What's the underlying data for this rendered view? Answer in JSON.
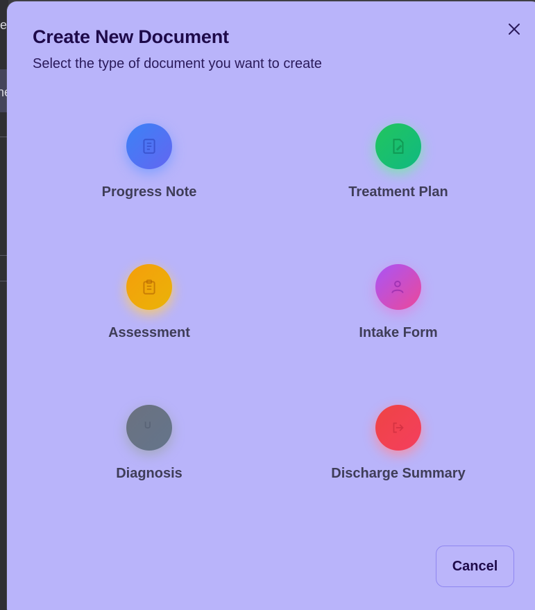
{
  "backdrop": {
    "text_1": "le",
    "text_2": "ne"
  },
  "modal": {
    "title": "Create New Document",
    "subtitle": "Select the type of document you want to create",
    "close_icon": "close-icon",
    "cancel_label": "Cancel"
  },
  "options": [
    {
      "label": "Progress Note",
      "icon": "note-icon",
      "gradient": [
        "#3b82f6",
        "#6366f1"
      ],
      "glow": "#7fa0ff"
    },
    {
      "label": "Treatment Plan",
      "icon": "document-edit-icon",
      "gradient": [
        "#22c55e",
        "#10b981"
      ],
      "glow": "#7ee2b0"
    },
    {
      "label": "Assessment",
      "icon": "clipboard-icon",
      "gradient": [
        "#f59e0b",
        "#eab308"
      ],
      "glow": "#f7c96b"
    },
    {
      "label": "Intake Form",
      "icon": "user-plus-icon",
      "gradient": [
        "#a855f7",
        "#ec4899"
      ],
      "glow": "#d58fe6"
    },
    {
      "label": "Diagnosis",
      "icon": "stethoscope-icon",
      "gradient": [
        "#6b7280",
        "#64748b"
      ],
      "glow": "#a3a8bd"
    },
    {
      "label": "Discharge Summary",
      "icon": "logout-icon",
      "gradient": [
        "#ef4444",
        "#f43f5e"
      ],
      "glow": "#f58fa6"
    }
  ]
}
